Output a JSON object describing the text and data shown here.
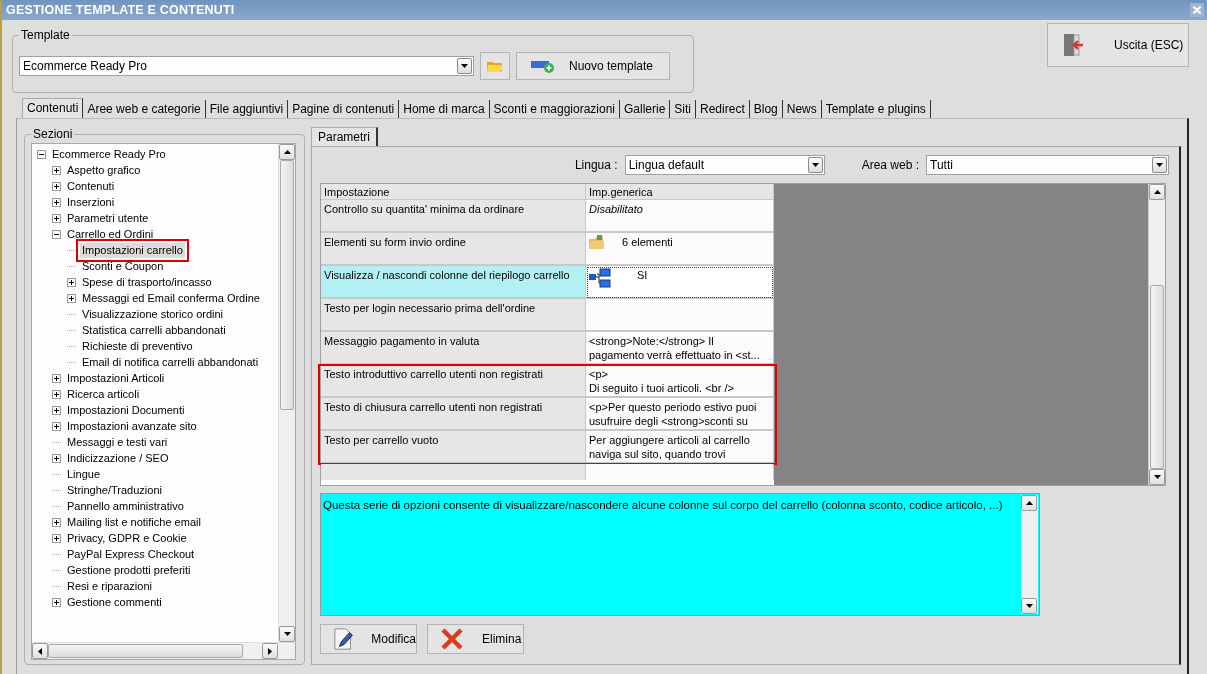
{
  "window": {
    "title": "GESTIONE TEMPLATE E CONTENUTI"
  },
  "template": {
    "label": "Template",
    "value": "Ecommerce Ready Pro",
    "new_button": "Nuovo template"
  },
  "exit_button": {
    "label": "Uscita (ESC)"
  },
  "tabs": [
    {
      "label": "Contenuti",
      "selected": true
    },
    {
      "label": "Aree web e categorie",
      "selected": false
    },
    {
      "label": "File aggiuntivi",
      "selected": false
    },
    {
      "label": "Pagine di contenuti",
      "selected": false
    },
    {
      "label": "Home di marca",
      "selected": false
    },
    {
      "label": "Sconti e maggiorazioni",
      "selected": false
    },
    {
      "label": "Gallerie",
      "selected": false
    },
    {
      "label": "Siti",
      "selected": false
    },
    {
      "label": "Redirect",
      "selected": false
    },
    {
      "label": "Blog",
      "selected": false
    },
    {
      "label": "News",
      "selected": false
    },
    {
      "label": "Template e plugins",
      "selected": false
    }
  ],
  "sections": {
    "title": "Sezioni",
    "tree": [
      {
        "label": "Ecommerce Ready Pro",
        "kind": "node",
        "expanded": true,
        "selected": false,
        "highlighted": false,
        "children": [
          {
            "label": "Aspetto grafico",
            "kind": "node",
            "expanded": false,
            "selected": false,
            "highlighted": false
          },
          {
            "label": "Contenuti",
            "kind": "node",
            "expanded": false,
            "selected": false,
            "highlighted": false
          },
          {
            "label": "Inserzioni",
            "kind": "node",
            "expanded": false,
            "selected": false,
            "highlighted": false
          },
          {
            "label": "Parametri utente",
            "kind": "node",
            "expanded": false,
            "selected": false,
            "highlighted": false
          },
          {
            "label": "Carrello ed Ordini",
            "kind": "node",
            "expanded": true,
            "selected": false,
            "highlighted": false,
            "children": [
              {
                "label": "Impostazioni carrello",
                "kind": "leaf",
                "selected": true,
                "highlighted": true
              },
              {
                "label": "Sconti e Coupon",
                "kind": "leaf",
                "selected": false,
                "highlighted": false
              },
              {
                "label": "Spese di trasporto/incasso",
                "kind": "node",
                "expanded": false,
                "selected": false,
                "highlighted": false
              },
              {
                "label": "Messaggi ed Email conferma Ordine",
                "kind": "node",
                "expanded": false,
                "selected": false,
                "highlighted": false
              },
              {
                "label": "Visualizzazione storico ordini",
                "kind": "leaf",
                "selected": false,
                "highlighted": false
              },
              {
                "label": "Statistica carrelli abbandonati",
                "kind": "leaf",
                "selected": false,
                "highlighted": false
              },
              {
                "label": "Richieste di preventivo",
                "kind": "leaf",
                "selected": false,
                "highlighted": false
              },
              {
                "label": "Email di notifica carrelli abbandonati",
                "kind": "leaf",
                "selected": false,
                "highlighted": false
              }
            ]
          },
          {
            "label": "Impostazioni Articoli",
            "kind": "node",
            "expanded": false,
            "selected": false,
            "highlighted": false
          },
          {
            "label": "Ricerca articoli",
            "kind": "node",
            "expanded": false,
            "selected": false,
            "highlighted": false
          },
          {
            "label": "Impostazioni Documenti",
            "kind": "node",
            "expanded": false,
            "selected": false,
            "highlighted": false
          },
          {
            "label": "Impostazioni avanzate sito",
            "kind": "node",
            "expanded": false,
            "selected": false,
            "highlighted": false
          },
          {
            "label": "Messaggi e testi vari",
            "kind": "leaf",
            "selected": false,
            "highlighted": false
          },
          {
            "label": "Indicizzazione / SEO",
            "kind": "node",
            "expanded": false,
            "selected": false,
            "highlighted": false
          },
          {
            "label": "Lingue",
            "kind": "leaf",
            "selected": false,
            "highlighted": false
          },
          {
            "label": "Stringhe/Traduzioni",
            "kind": "leaf",
            "selected": false,
            "highlighted": false
          },
          {
            "label": "Pannello amministrativo",
            "kind": "leaf",
            "selected": false,
            "highlighted": false
          },
          {
            "label": "Mailing list e notifiche email",
            "kind": "node",
            "expanded": false,
            "selected": false,
            "highlighted": false
          },
          {
            "label": "Privacy, GDPR e Cookie",
            "kind": "node",
            "expanded": false,
            "selected": false,
            "highlighted": false
          },
          {
            "label": "PayPal Express Checkout",
            "kind": "leaf",
            "selected": false,
            "highlighted": false
          },
          {
            "label": "Gestione prodotti preferiti",
            "kind": "leaf",
            "selected": false,
            "highlighted": false
          },
          {
            "label": "Resi e riparazioni",
            "kind": "leaf",
            "selected": false,
            "highlighted": false
          },
          {
            "label": "Gestione commenti",
            "kind": "node",
            "expanded": false,
            "selected": false,
            "highlighted": false
          }
        ]
      }
    ]
  },
  "subtabs": [
    {
      "label": "Parametri",
      "selected": true
    }
  ],
  "filters": [
    {
      "label": "Lingua :",
      "value": "Lingua default"
    },
    {
      "label": "Area web :",
      "value": "Tutti"
    }
  ],
  "table": {
    "columns": [
      "Impostazione",
      "Imp.generica"
    ],
    "rows": [
      {
        "setting": "Controllo su quantita' minima da ordinare",
        "kind": "italic",
        "value": "Disabilitato",
        "selected": false,
        "highlighted": false
      },
      {
        "setting": "Elementi su form invio ordine",
        "kind": "folder",
        "value": "6 elementi",
        "selected": false,
        "highlighted": false
      },
      {
        "setting": "Visualizza / nascondi colonne del riepilogo carrello",
        "kind": "hierarchy",
        "value": "SI",
        "selected": true,
        "highlighted": false
      },
      {
        "setting": "Testo per login necessario prima dell'ordine",
        "kind": "text",
        "selected": false,
        "highlighted": false
      },
      {
        "setting": "Messaggio pagamento in valuta",
        "kind": "text",
        "value": "<strong>Note:</strong> Il\npagamento verrà effettuato in <st...",
        "selected": false,
        "highlighted": false
      },
      {
        "setting": "Testo introduttivo carrello utenti non registrati",
        "kind": "text",
        "value": "<p>\nDi seguito i tuoi articoli. <br />",
        "selected": false,
        "highlighted": true
      },
      {
        "setting": "Testo di chiusura carrello utenti non registrati",
        "kind": "text",
        "value": "<p>Per questo periodo estivo puoi\nusufruire degli <strong>sconti su",
        "selected": false,
        "highlighted": true
      },
      {
        "setting": "Testo per carrello vuoto",
        "kind": "text",
        "value": "Per aggiungere articoli al carrello\nnaviga sul sito, quando trovi",
        "selected": false,
        "highlighted": true
      }
    ]
  },
  "description": "Questa serie di opzioni consente di visualizzare/nascondere alcune colonne sul corpo del carrello (colonna sconto, codice articolo, ...)",
  "actions": [
    {
      "label": "Modifica",
      "kind": "edit"
    },
    {
      "label": "Elimina",
      "kind": "delete"
    }
  ]
}
